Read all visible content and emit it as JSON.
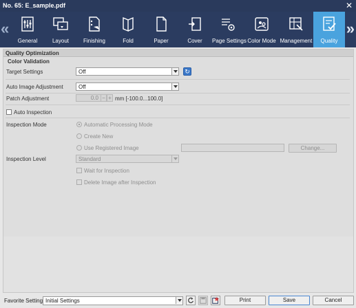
{
  "window": {
    "title": "No. 65: E_sample.pdf",
    "close_icon": "close-icon"
  },
  "ribbon": {
    "tabs": [
      {
        "label": "General",
        "icon": "general-icon"
      },
      {
        "label": "Layout",
        "icon": "layout-icon"
      },
      {
        "label": "Finishing",
        "icon": "finishing-icon"
      },
      {
        "label": "Fold",
        "icon": "fold-icon"
      },
      {
        "label": "Paper",
        "icon": "paper-icon"
      },
      {
        "label": "Cover",
        "icon": "cover-icon"
      },
      {
        "label": "Page Settings",
        "icon": "page-settings-icon"
      },
      {
        "label": "Color Mode",
        "icon": "color-mode-icon"
      },
      {
        "label": "Management",
        "icon": "management-icon"
      },
      {
        "label": "Quality",
        "icon": "quality-icon",
        "active": true
      }
    ],
    "left_arrow": "«",
    "right_arrow": "»"
  },
  "panel": {
    "section_title": "Quality Optimization",
    "subsection_title": "Color Validation",
    "target_settings": {
      "label": "Target Settings",
      "value": "Off"
    },
    "auto_image_adjustment": {
      "label": "Auto Image Adjustment",
      "value": "Off"
    },
    "patch_adjustment": {
      "label": "Patch Adjustment",
      "value": "0.0",
      "minus": "−",
      "plus": "+",
      "range": "mm [-100.0...100.0]"
    },
    "auto_inspection": {
      "label": "Auto Inspection",
      "checked": false
    },
    "inspection_mode": {
      "label": "Inspection Mode",
      "options": [
        {
          "label": "Automatic Processing Mode",
          "checked": true
        },
        {
          "label": "Create New",
          "checked": false
        },
        {
          "label": "Use Registered Image",
          "checked": false
        }
      ],
      "change_button": "Change..."
    },
    "inspection_level": {
      "label": "Inspection Level",
      "value": "Standard"
    },
    "wait_for_inspection": {
      "label": "Wait for Inspection"
    },
    "delete_image": {
      "label": "Delete Image after Inspection"
    }
  },
  "footer": {
    "favorite_label": "Favorite Setting",
    "favorite_value": "Initial Settings",
    "print": "Print",
    "save": "Save",
    "cancel": "Cancel"
  },
  "colors": {
    "titlebar": "#2a3a5c",
    "ribbon": "#2b3c60",
    "active_tab": "#4aa3de"
  }
}
